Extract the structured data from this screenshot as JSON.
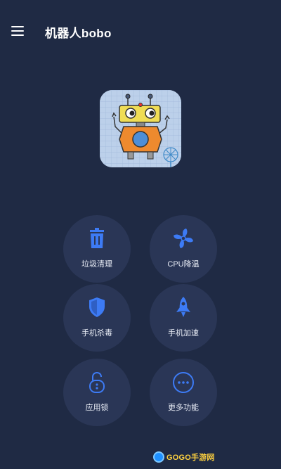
{
  "app": {
    "title": "机器人bobo"
  },
  "menu": {
    "icon": "menu-icon"
  },
  "colors": {
    "background": "#1f2a44",
    "button_bg": "#2a3656",
    "icon_blue": "#3d7bf5"
  },
  "features": [
    {
      "label": "垃圾清理",
      "icon": "trash-icon"
    },
    {
      "label": "CPU降温",
      "icon": "fan-icon"
    },
    {
      "label": "手机杀毒",
      "icon": "shield-icon"
    },
    {
      "label": "手机加速",
      "icon": "rocket-icon"
    },
    {
      "label": "应用锁",
      "icon": "unlock-icon"
    },
    {
      "label": "更多功能",
      "icon": "more-icon"
    }
  ],
  "watermark": {
    "text": "GOGO手游网"
  }
}
